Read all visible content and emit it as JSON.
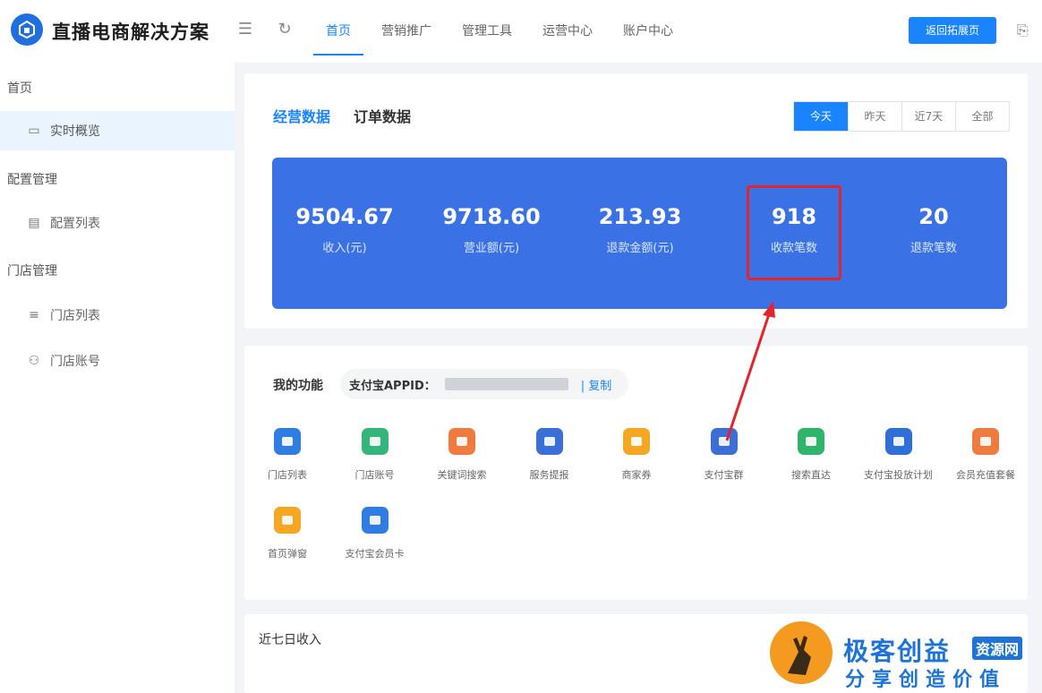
{
  "header": {
    "brand": "直播电商解决方案",
    "nav": [
      "首页",
      "营销推广",
      "管理工具",
      "运营中心",
      "账户中心"
    ],
    "active_nav": "首页",
    "return_button": "返回拓展页"
  },
  "sidebar": {
    "groups": [
      {
        "title": "首页",
        "items": [
          {
            "label": "实时概览",
            "icon": "monitor-icon",
            "active": true
          }
        ]
      },
      {
        "title": "配置管理",
        "items": [
          {
            "label": "配置列表",
            "icon": "document-icon"
          }
        ]
      },
      {
        "title": "门店管理",
        "items": [
          {
            "label": "门店列表",
            "icon": "list-icon"
          },
          {
            "label": "门店账号",
            "icon": "user-icon"
          }
        ]
      }
    ]
  },
  "overview": {
    "tabs": [
      "经营数据",
      "订单数据"
    ],
    "range_options": [
      "今天",
      "昨天",
      "近7天",
      "全部"
    ],
    "active_range": "今天",
    "stats": [
      {
        "value": "9504.67",
        "label": "收入(元)"
      },
      {
        "value": "9718.60",
        "label": "营业额(元)"
      },
      {
        "value": "213.93",
        "label": "退款金额(元)"
      },
      {
        "value": "918",
        "label": "收款笔数"
      },
      {
        "value": "20",
        "label": "退款笔数"
      }
    ]
  },
  "functions": {
    "title": "我的功能",
    "appid_label": "支付宝APPID：",
    "copy_label": "| 复制",
    "items": [
      {
        "label": "门店列表",
        "color": "#2f7de1",
        "icon": "store-icon"
      },
      {
        "label": "门店账号",
        "color": "#34b57a",
        "icon": "store-account-icon"
      },
      {
        "label": "关键词搜索",
        "color": "#f07b3f",
        "icon": "keyword-search-icon"
      },
      {
        "label": "服务提报",
        "color": "#3a6fd8",
        "icon": "service-report-icon"
      },
      {
        "label": "商家券",
        "color": "#f5a623",
        "icon": "coupon-icon"
      },
      {
        "label": "支付宝群",
        "color": "#3b6fd6",
        "icon": "group-icon"
      },
      {
        "label": "搜索直达",
        "color": "#2fb56b",
        "icon": "search-direct-icon"
      },
      {
        "label": "支付宝投放计划",
        "color": "#2f6fd8",
        "icon": "ad-icon"
      },
      {
        "label": "会员充值套餐",
        "color": "#f07b3f",
        "icon": "member-package-icon"
      },
      {
        "label": "首页弹窗",
        "color": "#f5a623",
        "icon": "popup-icon"
      },
      {
        "label": "支付宝会员卡",
        "color": "#2f7de1",
        "icon": "member-card-icon"
      }
    ]
  },
  "chart": {
    "title": "近七日收入"
  },
  "watermark": {
    "title": "极客创益",
    "tag": "资源网",
    "subtitle": "分享创造价值"
  }
}
